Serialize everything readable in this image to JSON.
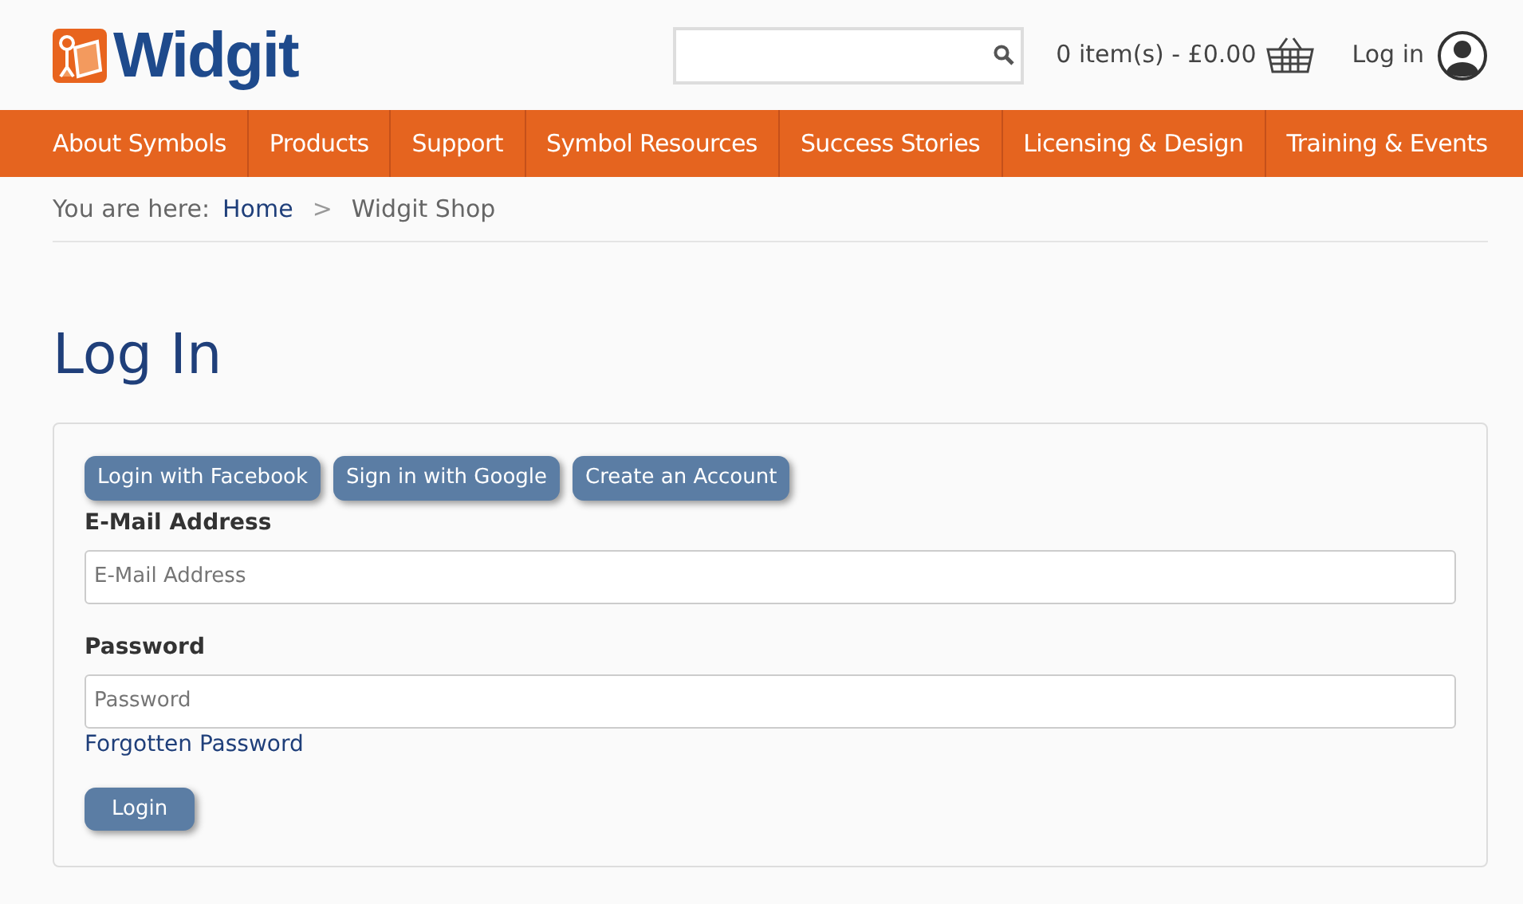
{
  "logo": {
    "text": "Widgit"
  },
  "cart": {
    "text": "0 item(s) - £0.00"
  },
  "account": {
    "label": "Log in"
  },
  "nav": [
    "About Symbols",
    "Products",
    "Support",
    "Symbol Resources",
    "Success Stories",
    "Licensing & Design",
    "Training & Events"
  ],
  "breadcrumb": {
    "prefix": "You are here:",
    "items": [
      "Home",
      "Widgit Shop"
    ],
    "separator": ">"
  },
  "title": "Log In",
  "social_buttons": [
    "Login with Facebook",
    "Sign in with Google",
    "Create an Account"
  ],
  "fields": [
    {
      "label": "E-Mail Address",
      "placeholder": "E-Mail Address"
    },
    {
      "label": "Password",
      "placeholder": "Password"
    }
  ],
  "forgot_link": "Forgotten Password",
  "submit": "Login"
}
